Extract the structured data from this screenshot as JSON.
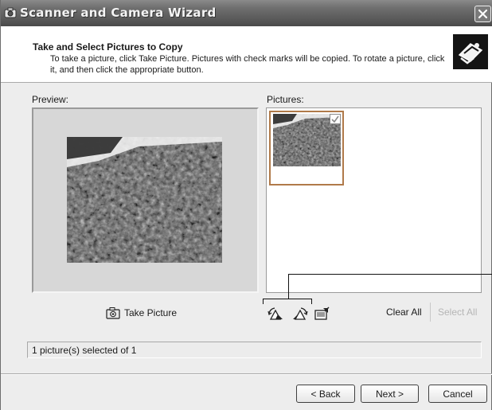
{
  "window": {
    "title": "Scanner and Camera Wizard",
    "icon": "camera-icon",
    "close_icon": "close-icon"
  },
  "header": {
    "title": "Take and Select Pictures to Copy",
    "subtitle": "To take a picture, click Take Picture. Pictures with check marks will be copied. To rotate a picture, click it, and then click the appropriate button.",
    "icon": "camera-wizard-icon"
  },
  "preview": {
    "label": "Preview:"
  },
  "pictures": {
    "label": "Pictures:",
    "items": [
      {
        "checked": true
      }
    ]
  },
  "toolbar": {
    "take_picture_label": "Take Picture",
    "take_picture_icon": "camera-icon",
    "rotate_left_icon": "rotate-left-icon",
    "rotate_right_icon": "rotate-right-icon",
    "properties_icon": "properties-icon",
    "clear_all_label": "Clear All",
    "select_all_label": "Select All"
  },
  "status": {
    "text": "1 picture(s) selected of 1"
  },
  "buttons": {
    "back": "< Back",
    "next": "Next >",
    "cancel": "Cancel"
  },
  "colors": {
    "titlebar": "#5b5b5b",
    "dialog_bg": "#ededed",
    "thumbnail_border": "#b07a4a"
  }
}
